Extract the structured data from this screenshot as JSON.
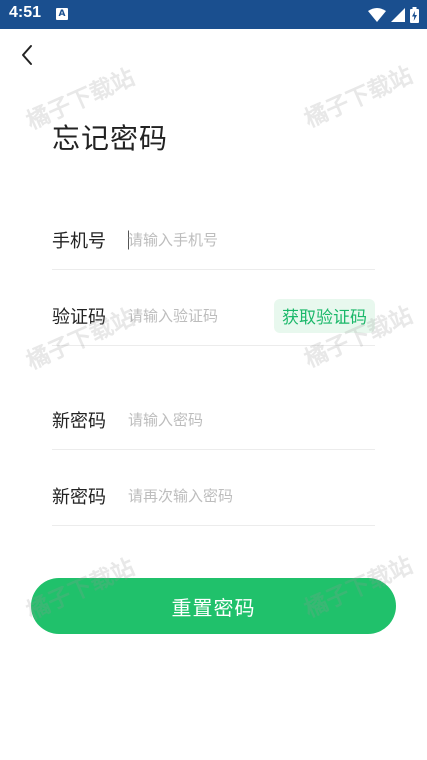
{
  "status_bar": {
    "time": "4:51",
    "notification_glyph": "A",
    "icons": [
      "wifi-icon",
      "signal-icon",
      "battery-charging-icon"
    ]
  },
  "header": {
    "back_icon": "chevron-left-icon"
  },
  "page": {
    "title": "忘记密码"
  },
  "form": {
    "phone": {
      "label": "手机号",
      "placeholder": "请输入手机号",
      "value": ""
    },
    "code": {
      "label": "验证码",
      "placeholder": "请输入验证码",
      "value": "",
      "get_code_label": "获取验证码"
    },
    "new_password": {
      "label": "新密码",
      "placeholder": "请输入密码",
      "value": ""
    },
    "confirm_password": {
      "label": "新密码",
      "placeholder": "请再次输入密码",
      "value": ""
    }
  },
  "actions": {
    "reset_label": "重置密码"
  },
  "watermark": "橘子下载站",
  "colors": {
    "status_bar": "#1a4f8f",
    "accent": "#20c16b",
    "code_button_bg": "#e8f8ee",
    "code_button_text": "#1bb86a",
    "placeholder": "#bdbdbd"
  }
}
